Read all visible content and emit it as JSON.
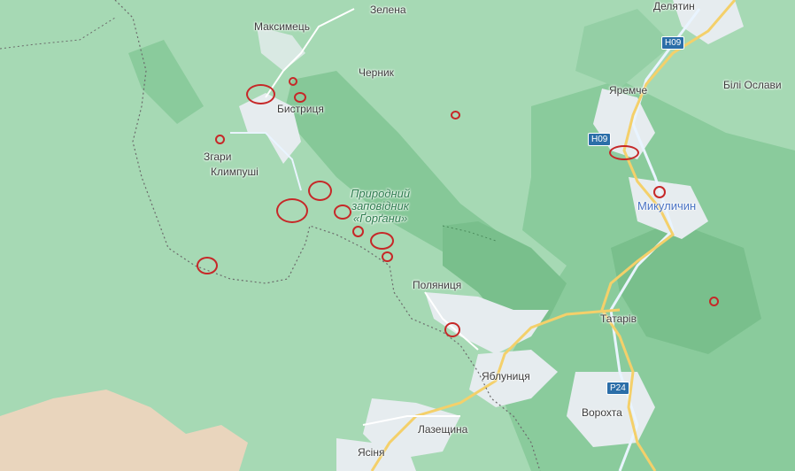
{
  "map": {
    "colors": {
      "land": "#a6d9b4",
      "forest": "#8acb9c",
      "reserve": "#79bf8c",
      "valley": "#e6ecef",
      "highland": "#e9d5bd",
      "road": "#f4d06a",
      "boundary": "#6b6b6b",
      "marker": "#c62828",
      "reserve_text": "#2f7d50",
      "highlight_text": "#4a73c4"
    },
    "labels": {
      "zelena": "Зелена",
      "delyatyn": "Делятин",
      "maksymets": "Максимець",
      "chernyk": "Черник",
      "bili_oslavy": "Білі Ослави",
      "yaremche": "Яремче",
      "bystrytsia": "Бистриця",
      "zgary": "Згари",
      "klympushi": "Климпуші",
      "reserve_line1": "Природний",
      "reserve_line2": "заповідник",
      "reserve_line3": "«Ґорґани»",
      "mykulychyn": "Микуличин",
      "polianytsia": "Поляниця",
      "tatariv": "Татарів",
      "yablunytsia": "Яблуниця",
      "vorokhta": "Ворохта",
      "lazeshchyna": "Лазещина",
      "yasinia": "Ясіня"
    },
    "road_shields": {
      "h09_north": "H09",
      "h09_south": "H09",
      "p24": "P24"
    },
    "marker_count": 16
  }
}
